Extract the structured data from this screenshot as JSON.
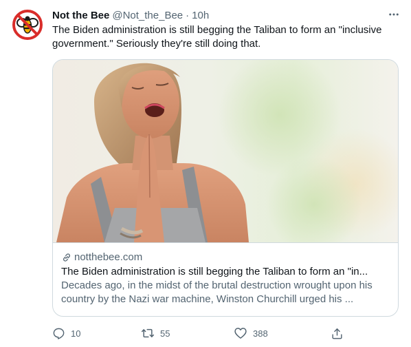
{
  "tweet": {
    "display_name": "Not the Bee",
    "handle": "@Not_the_Bee",
    "separator": "·",
    "time": "10h",
    "text": "The Biden administration is still begging the Taliban to form an \"inclusive government.\" Seriously they're still doing that.",
    "avatar_icon": "no-bee-logo"
  },
  "card": {
    "domain": "notthebee.com",
    "title": "The Biden administration is still begging the Taliban to form an \"in...",
    "description": "Decades ago, in the midst of the brutal destruction wrought upon his country by the Nazi war machine, Winston Churchill urged his ...",
    "image_subject": "woman-praying-photo"
  },
  "actions": {
    "reply_count": "10",
    "retweet_count": "55",
    "like_count": "388"
  },
  "colors": {
    "text_primary": "#0f1419",
    "text_secondary": "#536471",
    "border": "#cfd9de",
    "logo_red": "#d92d2a",
    "logo_yellow": "#f4b400"
  }
}
